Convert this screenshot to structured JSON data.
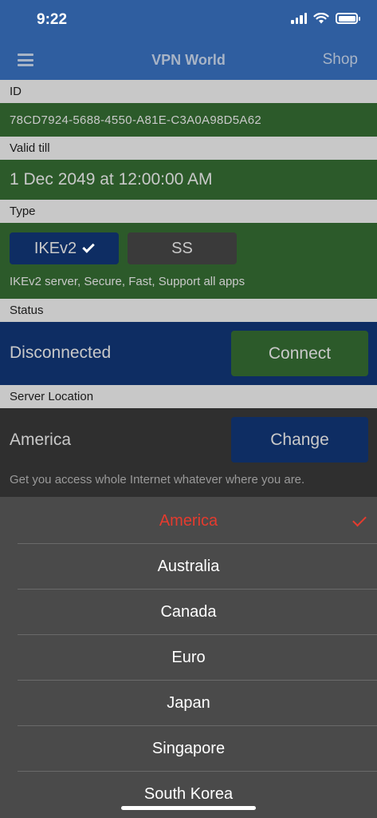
{
  "status_bar": {
    "time": "9:22"
  },
  "nav": {
    "title": "VPN World",
    "shop": "Shop"
  },
  "id_section": {
    "label": "ID",
    "value": "78CD7924-5688-4550-A81E-C3A0A98D5A62"
  },
  "valid_section": {
    "label": "Valid till",
    "value": "1 Dec 2049 at 12:00:00 AM"
  },
  "type_section": {
    "label": "Type",
    "ikev2_label": "IKEv2",
    "ss_label": "SS",
    "selected": "IKEv2",
    "description": "IKEv2 server, Secure, Fast, Support all apps"
  },
  "status_section": {
    "label": "Status",
    "value": "Disconnected",
    "connect_label": "Connect"
  },
  "location_section": {
    "label": "Server Location",
    "value": "America",
    "change_label": "Change",
    "description": "Get you access whole Internet whatever where you are."
  },
  "picker": {
    "selected": "America",
    "items": [
      "America",
      "Australia",
      "Canada",
      "Euro",
      "Japan",
      "Singapore",
      "South Korea"
    ]
  },
  "colors": {
    "nav_blue": "#2f5ea0",
    "green_row": "#2c5a2a",
    "status_blue": "#0e2d63",
    "selected_red": "#e53b2e"
  }
}
